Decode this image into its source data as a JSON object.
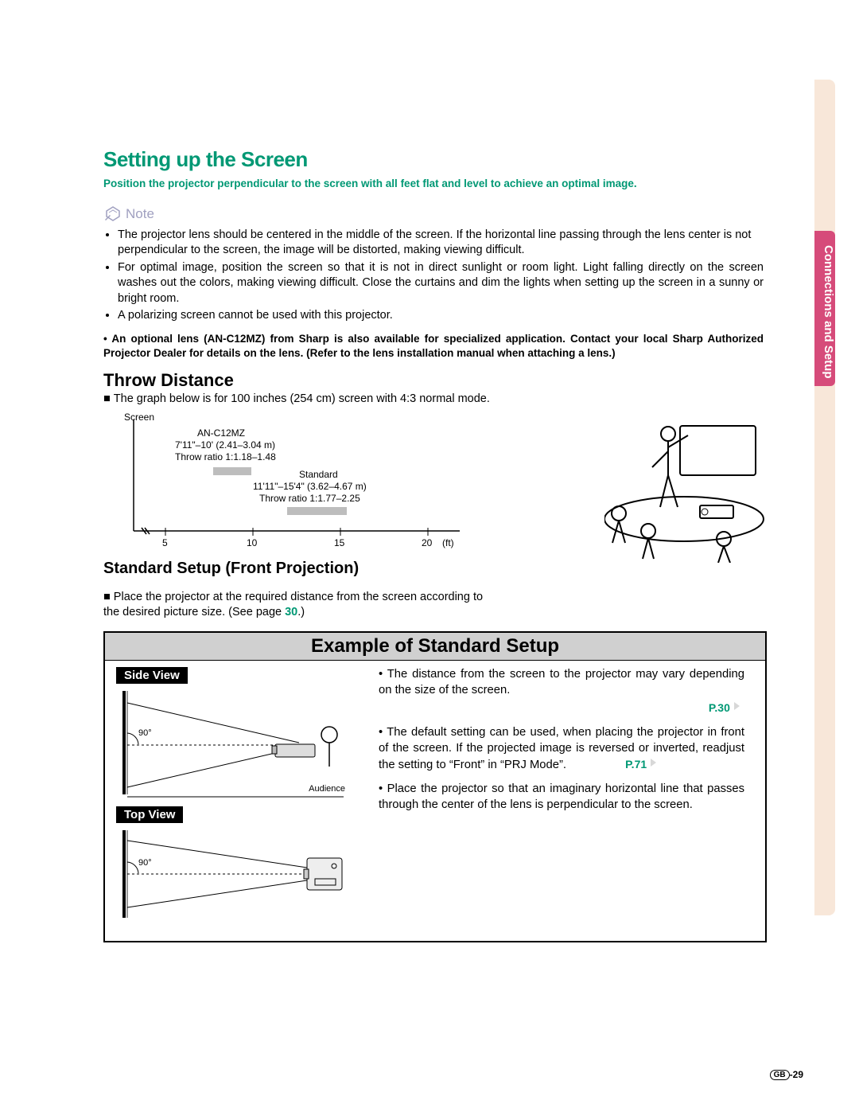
{
  "side_tab": {
    "label": "Connections and Setup"
  },
  "title": "Setting up the Screen",
  "intro": "Position the projector perpendicular to the screen with all feet flat and level to achieve an optimal image.",
  "note_label": "Note",
  "note_bullets": [
    "The projector lens should be centered in the middle of the screen. If the horizontal line passing through the lens center is not perpendicular to the screen, the image will be distorted, making viewing difficult.",
    "For optimal image, position the screen so that it is not in direct sunlight or room light. Light falling directly on the screen washes out the colors, making viewing difficult. Close the curtains and dim the lights when setting up the screen in a sunny or bright room.",
    "A polarizing screen cannot be used with this projector."
  ],
  "bold_bullet": "An optional lens (AN-C12MZ) from Sharp is also available for specialized application. Contact your local Sharp Authorized Projector Dealer for details on the lens. (Refer to the lens installation manual when attaching a lens.)",
  "throw": {
    "heading": "Throw Distance",
    "desc_prefix": "■ ",
    "desc": "The graph below is for 100 inches (254 cm) screen with 4:3 normal mode."
  },
  "chart_data": {
    "type": "bar",
    "title": "",
    "xlabel": "(ft)",
    "ylabel": "",
    "y_axis_label": "Screen",
    "x_ticks": [
      5,
      10,
      15,
      20
    ],
    "series": [
      {
        "name": "AN-C12MZ",
        "range_ft": [
          7.92,
          10.0
        ],
        "label_lines": [
          "AN-C12MZ",
          "7'11\"–10' (2.41–3.04 m)",
          "Throw ratio 1:1.18–1.48"
        ]
      },
      {
        "name": "Standard",
        "range_ft": [
          11.92,
          15.33
        ],
        "label_lines": [
          "Standard",
          "11'11\"–15'4\" (3.62–4.67 m)",
          "Throw ratio 1:1.77–2.25"
        ]
      }
    ]
  },
  "standard_setup": {
    "heading": "Standard Setup (Front Projection)",
    "desc_prefix": "■ ",
    "desc": "Place the projector at the required distance from the screen according to the desired picture size. (See page ",
    "page_link": "30",
    "desc_suffix": ".)"
  },
  "example": {
    "title": "Example of Standard Setup",
    "side_label": "Side View",
    "top_label": "Top View",
    "side_angle": "90°",
    "top_angle": "90°",
    "audience_label": "Audience",
    "right_items": [
      {
        "text": "The distance from the screen to the projector may vary depending on the size of the screen.",
        "pref": "P.30"
      },
      {
        "text": "The default setting can be used, when placing the projector in front of the screen. If the projected image is reversed or inverted, readjust the setting to “Front” in “PRJ Mode”.",
        "pref": "P.71"
      },
      {
        "text": "Place the projector so that an imaginary horizontal line that passes through the center of the lens is perpendicular to the screen.",
        "pref": ""
      }
    ]
  },
  "footer": {
    "gb": "GB",
    "page": "-29"
  }
}
